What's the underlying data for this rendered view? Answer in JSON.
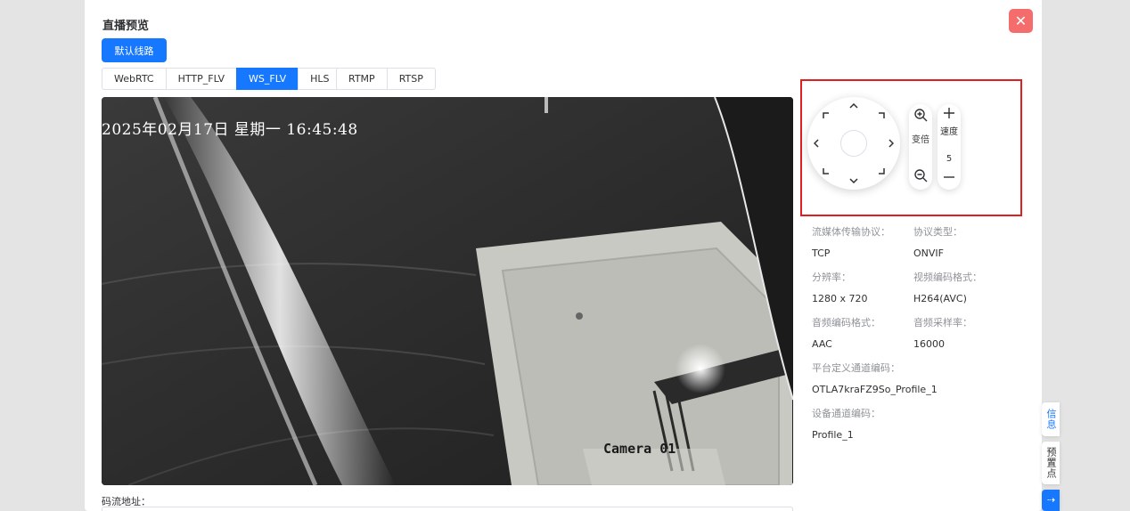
{
  "dialog": {
    "title": "直播预览",
    "close_icon": "close-icon"
  },
  "route_button": "默认线路",
  "protocol_tabs": {
    "group1": [
      "WebRTC",
      "HTTP_FLV",
      "WS_FLV",
      "HLS"
    ],
    "group2": [
      "RTMP",
      "RTSP"
    ],
    "active": "WS_FLV"
  },
  "video": {
    "osd_time": "2025年02月17日  星期一  16:45:48",
    "camera_label": "Camera 01"
  },
  "stream_address_label": "码流地址：",
  "ptz": {
    "zoom_label": "变倍",
    "speed_label": "速度",
    "speed_value": "5"
  },
  "info": {
    "transport_label": "流媒体传输协议：",
    "transport_value": "TCP",
    "protocol_type_label": "协议类型：",
    "protocol_type_value": "ONVIF",
    "resolution_label": "分辨率：",
    "resolution_value": "1280 x 720",
    "video_codec_label": "视频编码格式：",
    "video_codec_value": "H264(AVC)",
    "audio_codec_label": "音频编码格式：",
    "audio_codec_value": "AAC",
    "audio_rate_label": "音频采样率：",
    "audio_rate_value": "16000",
    "platform_channel_label": "平台定义通道编码：",
    "platform_channel_value": "OTLA7kraFZ9So_Profile_1",
    "device_channel_label": "设备通道编码：",
    "device_channel_value": "Profile_1"
  },
  "side_tabs": [
    "信息",
    "预置点"
  ],
  "colors": {
    "primary": "#1677ff",
    "danger": "#f56c6c",
    "highlight_border": "#e02020"
  }
}
